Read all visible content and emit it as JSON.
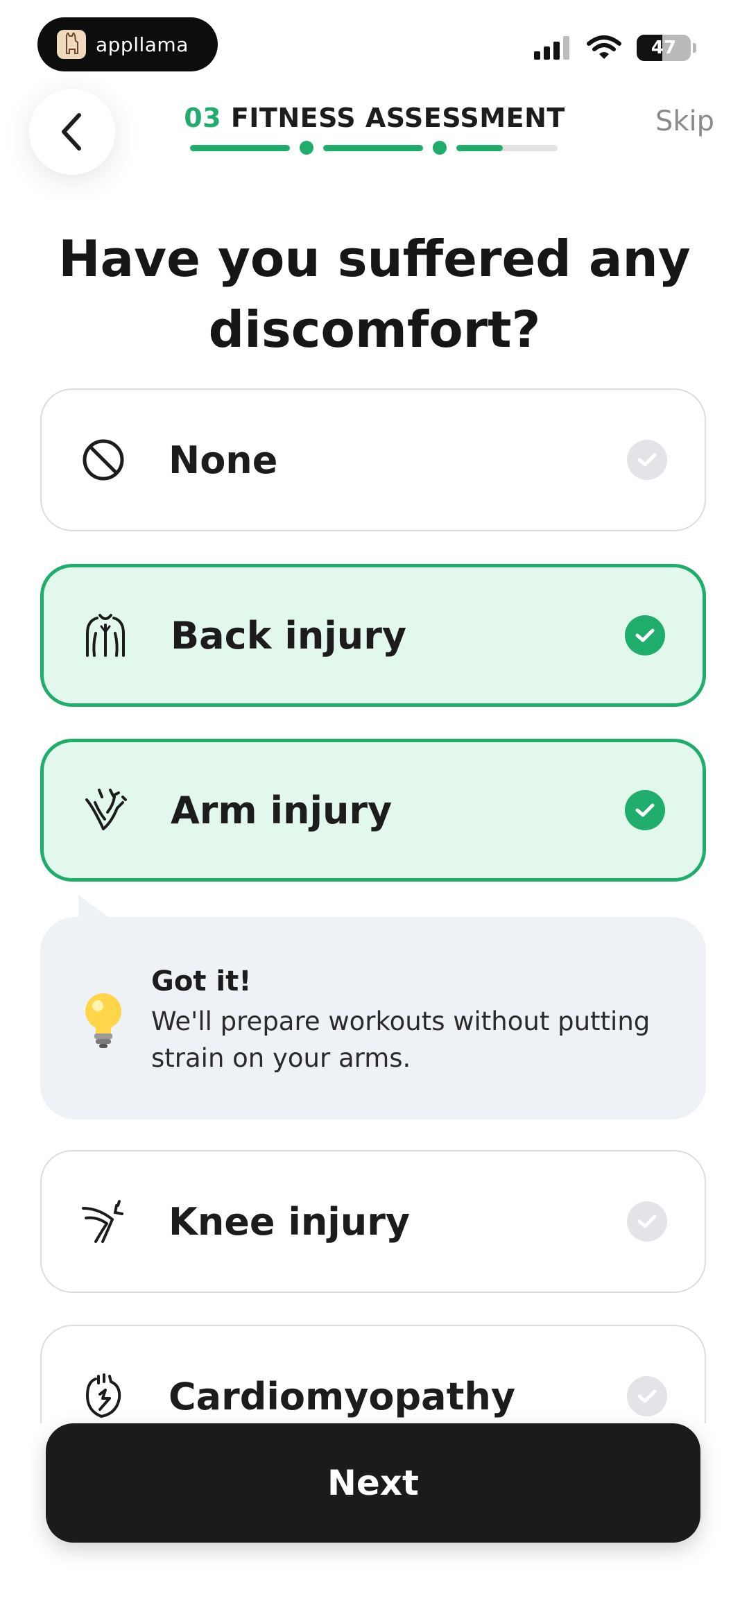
{
  "status_bar": {
    "brand_name": "appllama",
    "battery_level": "47",
    "battery_percent": 47
  },
  "header": {
    "step_number": "03",
    "step_title": "FITNESS ASSESSMENT",
    "skip_label": "Skip",
    "progress_fraction": 0.82
  },
  "question": "Have you suffered any discomfort?",
  "options": [
    {
      "label": "None",
      "icon": "block-icon",
      "selected": false
    },
    {
      "label": "Back injury",
      "icon": "back-icon",
      "selected": true
    },
    {
      "label": "Arm injury",
      "icon": "arm-icon",
      "selected": true
    },
    {
      "label": "Knee injury",
      "icon": "knee-icon",
      "selected": false
    },
    {
      "label": "Cardiomyopathy",
      "icon": "heart-icon",
      "selected": false
    }
  ],
  "info": {
    "title": "Got it!",
    "body": "We'll prepare workouts without putting strain on your arms.",
    "icon": "lightbulb-icon"
  },
  "next_label": "Next",
  "colors": {
    "accent": "#1fad6b",
    "selected_bg": "#e3f8ec",
    "info_bg": "#eef1f5",
    "button_bg": "#1b1b1b"
  }
}
